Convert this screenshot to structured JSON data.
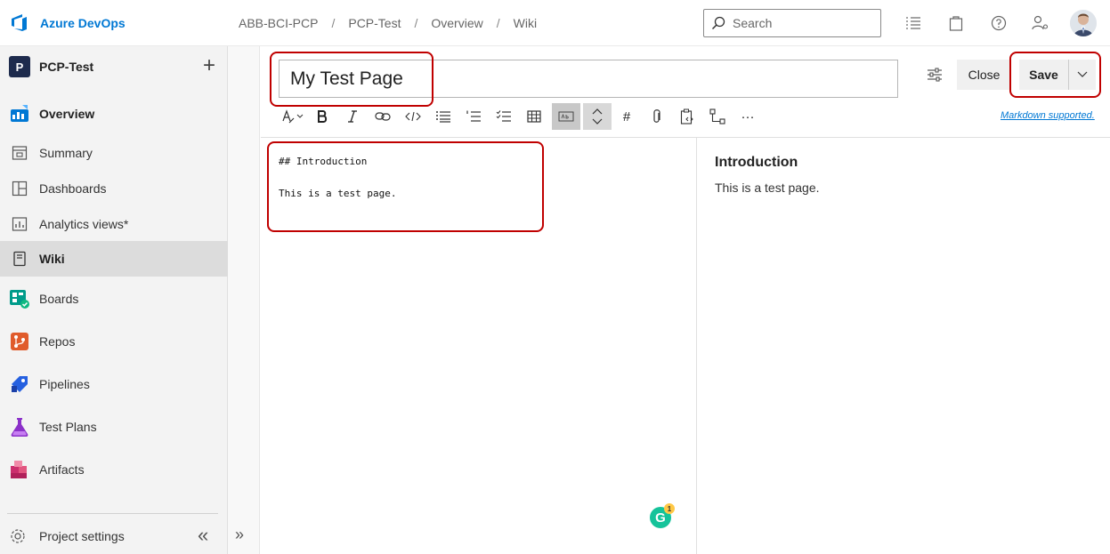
{
  "header": {
    "brand": "Azure DevOps",
    "breadcrumbs": [
      "ABB-BCI-PCP",
      "PCP-Test",
      "Overview",
      "Wiki"
    ],
    "breadcrumb_sep": "/",
    "search_placeholder": "Search"
  },
  "sidebar": {
    "project_initial": "P",
    "project_name": "PCP-Test",
    "add_symbol": "+",
    "items": [
      {
        "label": "Overview",
        "icon": "overview-icon"
      },
      {
        "label": "Summary",
        "icon": "summary-icon"
      },
      {
        "label": "Dashboards",
        "icon": "dashboards-icon"
      },
      {
        "label": "Analytics views*",
        "icon": "analytics-icon"
      },
      {
        "label": "Wiki",
        "icon": "wiki-icon",
        "selected": true
      },
      {
        "label": "Boards",
        "icon": "boards-icon"
      },
      {
        "label": "Repos",
        "icon": "repos-icon"
      },
      {
        "label": "Pipelines",
        "icon": "pipelines-icon"
      },
      {
        "label": "Test Plans",
        "icon": "test-plans-icon"
      },
      {
        "label": "Artifacts",
        "icon": "artifacts-icon"
      }
    ],
    "settings_label": "Project settings",
    "collapse_symbol": "«"
  },
  "editor": {
    "page_title": "My Test Page",
    "close_label": "Close",
    "save_label": "Save",
    "markdown_link": "Markdown supported.",
    "source_line1": "## Introduction",
    "source_line2": "This is a test page.",
    "preview_heading": "Introduction",
    "preview_text": "This is a test page.",
    "expand_symbol": "»",
    "grammarly_letter": "G",
    "grammarly_count": "1",
    "toolbar_more": "···",
    "toolbar_hash": "#"
  },
  "colors": {
    "accent": "#0078d4",
    "annotation": "#c00000",
    "sidebar_bg": "#f3f3f3"
  }
}
